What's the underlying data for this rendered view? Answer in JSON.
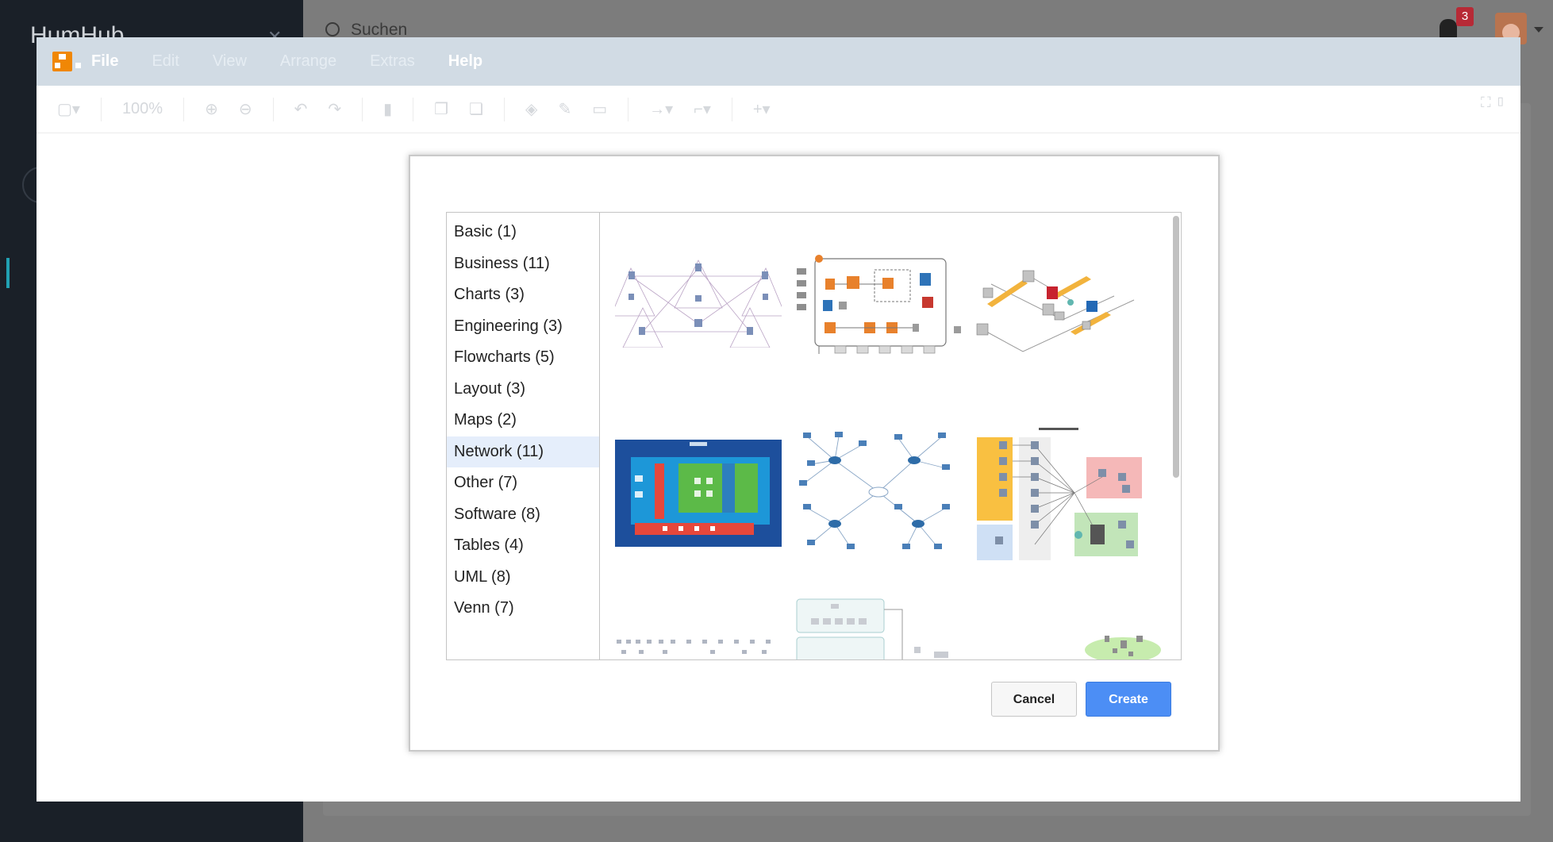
{
  "background": {
    "brand": "HumHub",
    "search_placeholder": "Suchen",
    "notification_count": "3"
  },
  "menubar": {
    "items": [
      "File",
      "Edit",
      "View",
      "Arrange",
      "Extras",
      "Help"
    ]
  },
  "toolbar": {
    "zoom": "100%"
  },
  "dialog": {
    "categories": [
      "Basic (1)",
      "Business (11)",
      "Charts (3)",
      "Engineering (3)",
      "Flowcharts (5)",
      "Layout (3)",
      "Maps (2)",
      "Network (11)",
      "Other (7)",
      "Software (8)",
      "Tables (4)",
      "UML (8)",
      "Venn (7)"
    ],
    "selected_category": "Network (11)",
    "cancel_label": "Cancel",
    "create_label": "Create"
  },
  "colors": {
    "accent": "#4c8ef5",
    "menubar": "#d1dbe4",
    "selected_row": "#e5eefb",
    "drawio_orange": "#f08705"
  }
}
